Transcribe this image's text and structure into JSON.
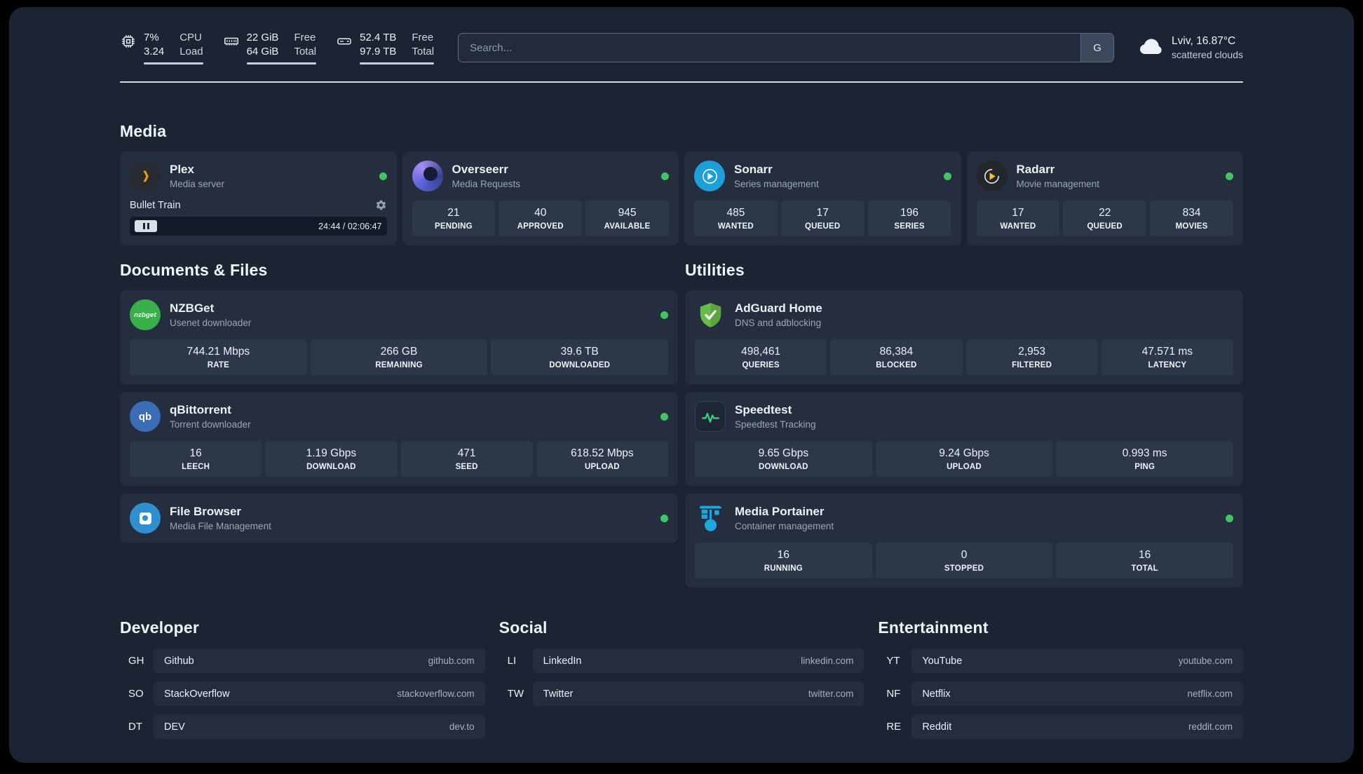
{
  "theme": {
    "status_green": "#43c464",
    "plex_amber": "#e5a00d",
    "adguard_green": "#68bc49",
    "portainer_blue": "#1ba8e0",
    "speedtest_green": "#37d07f"
  },
  "header": {
    "system": [
      {
        "icon": "cpu-icon",
        "primary_top": "7%",
        "primary_bottom": "3.24",
        "secondary_top": "CPU",
        "secondary_bottom": "Load"
      },
      {
        "icon": "ram-icon",
        "primary_top": "22 GiB",
        "primary_bottom": "64 GiB",
        "secondary_top": "Free",
        "secondary_bottom": "Total"
      },
      {
        "icon": "disk-icon",
        "primary_top": "52.4 TB",
        "primary_bottom": "97.9 TB",
        "secondary_top": "Free",
        "secondary_bottom": "Total"
      }
    ],
    "search": {
      "placeholder": "Search...",
      "provider_label": "G"
    },
    "weather": {
      "icon": "cloud-icon",
      "location": "Lviv, 16.87°C",
      "condition": "scattered clouds"
    }
  },
  "media": {
    "title": "Media",
    "cards": [
      {
        "icon": "plex-icon",
        "title": "Plex",
        "subtitle": "Media server",
        "online": true,
        "player": {
          "track": "Bullet Train",
          "time": "24:44 / 02:06:47"
        }
      },
      {
        "icon": "overseerr-icon",
        "title": "Overseerr",
        "subtitle": "Media Requests",
        "online": true,
        "stats": [
          {
            "value": "21",
            "label": "PENDING"
          },
          {
            "value": "40",
            "label": "APPROVED"
          },
          {
            "value": "945",
            "label": "AVAILABLE"
          }
        ]
      },
      {
        "icon": "sonarr-icon",
        "title": "Sonarr",
        "subtitle": "Series management",
        "online": true,
        "stats": [
          {
            "value": "485",
            "label": "WANTED"
          },
          {
            "value": "17",
            "label": "QUEUED"
          },
          {
            "value": "196",
            "label": "SERIES"
          }
        ]
      },
      {
        "icon": "radarr-icon",
        "title": "Radarr",
        "subtitle": "Movie management",
        "online": true,
        "stats": [
          {
            "value": "17",
            "label": "WANTED"
          },
          {
            "value": "22",
            "label": "QUEUED"
          },
          {
            "value": "834",
            "label": "MOVIES"
          }
        ]
      }
    ]
  },
  "documents": {
    "title": "Documents & Files",
    "cards": [
      {
        "icon": "nzbget-icon",
        "title": "NZBGet",
        "subtitle": "Usenet downloader",
        "online": true,
        "stats": [
          {
            "value": "744.21 Mbps",
            "label": "RATE"
          },
          {
            "value": "266 GB",
            "label": "REMAINING"
          },
          {
            "value": "39.6 TB",
            "label": "DOWNLOADED"
          }
        ]
      },
      {
        "icon": "qbittorrent-icon",
        "title": "qBittorrent",
        "subtitle": "Torrent downloader",
        "online": true,
        "stats": [
          {
            "value": "16",
            "label": "LEECH"
          },
          {
            "value": "1.19 Gbps",
            "label": "DOWNLOAD"
          },
          {
            "value": "471",
            "label": "SEED"
          },
          {
            "value": "618.52 Mbps",
            "label": "UPLOAD"
          }
        ]
      },
      {
        "icon": "filebrowser-icon",
        "title": "File Browser",
        "subtitle": "Media File Management",
        "online": true,
        "stats": []
      }
    ]
  },
  "utilities": {
    "title": "Utilities",
    "cards": [
      {
        "icon": "adguard-icon",
        "title": "AdGuard Home",
        "subtitle": "DNS and adblocking",
        "online": false,
        "stats": [
          {
            "value": "498,461",
            "label": "QUERIES"
          },
          {
            "value": "86,384",
            "label": "BLOCKED"
          },
          {
            "value": "2,953",
            "label": "FILTERED"
          },
          {
            "value": "47.571 ms",
            "label": "LATENCY"
          }
        ]
      },
      {
        "icon": "speedtest-icon",
        "title": "Speedtest",
        "subtitle": "Speedtest Tracking",
        "online": false,
        "stats": [
          {
            "value": "9.65 Gbps",
            "label": "DOWNLOAD"
          },
          {
            "value": "9.24 Gbps",
            "label": "UPLOAD"
          },
          {
            "value": "0.993 ms",
            "label": "PING"
          }
        ]
      },
      {
        "icon": "portainer-icon",
        "title": "Media Portainer",
        "subtitle": "Container management",
        "online": true,
        "stats": [
          {
            "value": "16",
            "label": "RUNNING"
          },
          {
            "value": "0",
            "label": "STOPPED"
          },
          {
            "value": "16",
            "label": "TOTAL"
          }
        ]
      }
    ]
  },
  "bookmarks": [
    {
      "title": "Developer",
      "items": [
        {
          "abbr": "GH",
          "name": "Github",
          "domain": "github.com"
        },
        {
          "abbr": "SO",
          "name": "StackOverflow",
          "domain": "stackoverflow.com"
        },
        {
          "abbr": "DT",
          "name": "DEV",
          "domain": "dev.to"
        }
      ]
    },
    {
      "title": "Social",
      "items": [
        {
          "abbr": "LI",
          "name": "LinkedIn",
          "domain": "linkedin.com"
        },
        {
          "abbr": "TW",
          "name": "Twitter",
          "domain": "twitter.com"
        }
      ]
    },
    {
      "title": "Entertainment",
      "items": [
        {
          "abbr": "YT",
          "name": "YouTube",
          "domain": "youtube.com"
        },
        {
          "abbr": "NF",
          "name": "Netflix",
          "domain": "netflix.com"
        },
        {
          "abbr": "RE",
          "name": "Reddit",
          "domain": "reddit.com"
        }
      ]
    }
  ]
}
